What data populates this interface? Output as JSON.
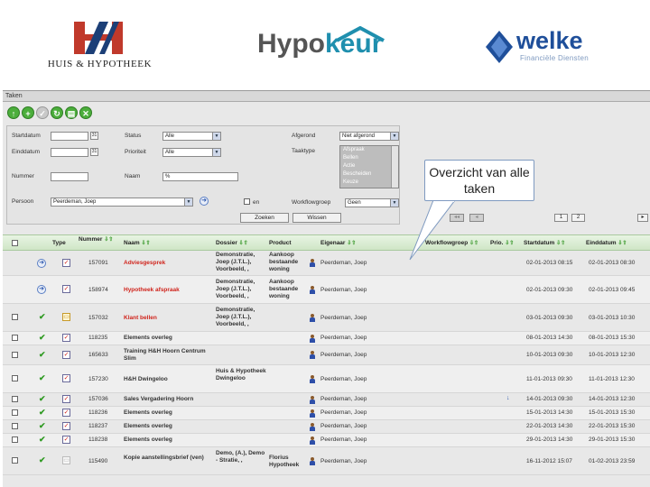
{
  "logos": {
    "huis_hypotheek": "HUIS & HYPOTHEEK",
    "hypokeur_part1": "Hypo",
    "hypokeur_part2": "keur",
    "welke": "welke",
    "welke_sub": "Financiële Diensten"
  },
  "window": {
    "title": "Taken"
  },
  "toolbar": {
    "buttons": [
      {
        "glyph": "↑",
        "icon": "arrow-up-icon"
      },
      {
        "glyph": "+",
        "icon": "add-icon"
      },
      {
        "glyph": "✓",
        "icon": "check-icon"
      },
      {
        "glyph": "↻",
        "icon": "refresh-icon"
      },
      {
        "glyph": "▤",
        "icon": "print-icon"
      },
      {
        "glyph": "✕",
        "icon": "delete-icon"
      }
    ]
  },
  "filter": {
    "startdatum_label": "Startdatum",
    "einddatum_label": "Einddatum",
    "nummer_label": "Nummer",
    "persoon_label": "Persoon",
    "persoon_value": "Peerdeman, Joep",
    "status_label": "Status",
    "status_value": "Alle",
    "prioriteit_label": "Prioriteit",
    "prioriteit_value": "Alle",
    "naam_label": "Naam",
    "naam_value": "%",
    "afgerond_label": "Afgerond",
    "afgerond_value": "Niet afgerond",
    "taaktype_label": "Taaktype",
    "taaktype_options": [
      "Afspraak",
      "Bellen",
      "Actie",
      "Bescheiden",
      "Keuze"
    ],
    "en_label": "en",
    "workflowgroep_label": "Workflowgroep",
    "workflowgroep_value": "Geen",
    "zoeken_label": "Zoeken",
    "wissen_label": "Wissen",
    "cal_glyph": "31"
  },
  "pager": {
    "prev": "◂◂",
    "prev2": "◂",
    "page1": "1",
    "page2": "2",
    "next": "▸"
  },
  "callout": {
    "text": "Overzicht van alle taken"
  },
  "grid": {
    "sort_glyph": "⇩⇧",
    "headers": {
      "type": "Type",
      "nummer": "Nummer",
      "naam": "Naam",
      "dossier": "Dossier",
      "product": "Product",
      "eigenaar": "Eigenaar",
      "workflowgroep": "Workflowgroep",
      "prio": "Prio.",
      "startdatum": "Startdatum",
      "einddatum": "Einddatum"
    },
    "rows": [
      {
        "nummer": "157091",
        "naam": "Adviesgesprek",
        "dossier": "Demonstratie, Joep (J.T.L.), Voorbeeld, ,",
        "product": "Aankoop bestaande woning",
        "eigenaar": "Peerdeman, Joep",
        "start": "02-01-2013 08:15",
        "eind": "02-01-2013 08:30"
      },
      {
        "nummer": "158974",
        "naam": "Hypotheek afspraak",
        "dossier": "Demonstratie, Joep (J.T.L.), Voorbeeld, ,",
        "product": "Aankoop bestaande woning",
        "eigenaar": "Peerdeman, Joep",
        "start": "02-01-2013 09:30",
        "eind": "02-01-2013 09:45"
      },
      {
        "nummer": "157032",
        "naam": "Klant bellen",
        "dossier": "Demonstratie, Joep (J.T.L.), Voorbeeld, ,",
        "product": "",
        "eigenaar": "Peerdeman, Joep",
        "start": "03-01-2013 09:30",
        "eind": "03-01-2013 10:30"
      },
      {
        "nummer": "118235",
        "naam": "Elements overleg",
        "dossier": "",
        "product": "",
        "eigenaar": "Peerdeman, Joep",
        "start": "08-01-2013 14:30",
        "eind": "08-01-2013 15:30"
      },
      {
        "nummer": "165633",
        "naam": "Training H&H Hoorn Centrum Slim",
        "dossier": "",
        "product": "",
        "eigenaar": "Peerdeman, Joep",
        "start": "10-01-2013 09:30",
        "eind": "10-01-2013 12:30"
      },
      {
        "nummer": "157230",
        "naam": "H&H Dwingeloo",
        "dossier": "Huis & Hypotheek Dwingeloo",
        "product": "",
        "eigenaar": "Peerdeman, Joep",
        "start": "11-01-2013 09:30",
        "eind": "11-01-2013 12:30"
      },
      {
        "nummer": "157036",
        "naam": "Sales Vergadering Hoorn",
        "dossier": "",
        "product": "",
        "eigenaar": "Peerdeman, Joep",
        "start": "14-01-2013 09:30",
        "eind": "14-01-2013 12:30"
      },
      {
        "nummer": "118236",
        "naam": "Elements overleg",
        "dossier": "",
        "product": "",
        "eigenaar": "Peerdeman, Joep",
        "start": "15-01-2013 14:30",
        "eind": "15-01-2013 15:30"
      },
      {
        "nummer": "118237",
        "naam": "Elements overleg",
        "dossier": "",
        "product": "",
        "eigenaar": "Peerdeman, Joep",
        "start": "22-01-2013 14:30",
        "eind": "22-01-2013 15:30"
      },
      {
        "nummer": "118238",
        "naam": "Elements overleg",
        "dossier": "",
        "product": "",
        "eigenaar": "Peerdeman, Joep",
        "start": "29-01-2013 14:30",
        "eind": "29-01-2013 15:30"
      },
      {
        "nummer": "115490",
        "naam": "Kopie aanstellingsbrief (ven)",
        "dossier": "Demo, (A.), Demo - Stratie, ,",
        "product": "Florius Hypotheek",
        "eigenaar": "Peerdeman, Joep",
        "start": "16-11-2012 15:07",
        "eind": "01-02-2013 23:59"
      }
    ]
  },
  "colors": {
    "header_green": "#cfe6c6",
    "accent_blue": "#1f8fae",
    "urgent_red": "#d0241c"
  }
}
